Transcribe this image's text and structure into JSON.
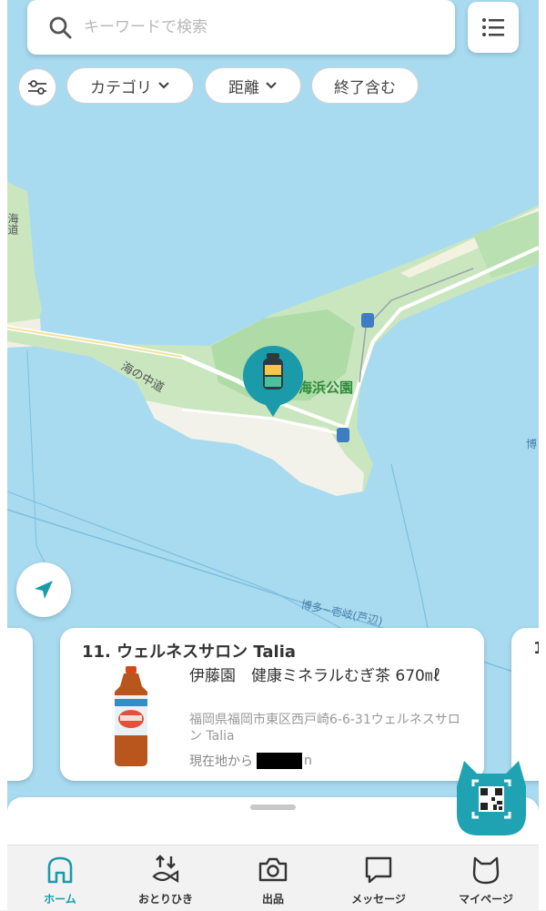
{
  "search": {
    "placeholder": "キーワードで検索"
  },
  "filters": [
    {
      "label": "カテゴリ",
      "has_dropdown": true
    },
    {
      "label": "距離",
      "has_dropdown": true
    },
    {
      "label": "終了含む",
      "has_dropdown": false
    }
  ],
  "map": {
    "labels": {
      "park": "海浜公園",
      "road_umi": "海の中道",
      "road_left": "海道",
      "ferry": "博多~壱岐(芦辺)",
      "right_edge": "博"
    },
    "marker_icon": "bottle-icon"
  },
  "cards": {
    "left_peek": "",
    "main": {
      "title": "11. ウェルネスサロン Talia",
      "product": "伊藤園　健康ミネラルむぎ茶 670㎖",
      "address": "福岡県福岡市東区西戸崎6-6-31ウェルネスサロン Talia",
      "distance_prefix": "現在地から",
      "distance_suffix": "n",
      "product_image": "mugicha-bottle"
    },
    "right_peek": "1"
  },
  "tabs": [
    {
      "label": "ホーム",
      "icon": "home-icon",
      "active": true
    },
    {
      "label": "おとりひき",
      "icon": "exchange-icon",
      "active": false
    },
    {
      "label": "出品",
      "icon": "camera-icon",
      "active": false
    },
    {
      "label": "メッセージ",
      "icon": "message-icon",
      "active": false
    },
    {
      "label": "マイページ",
      "icon": "cat-face-icon",
      "active": false
    }
  ],
  "colors": {
    "accent": "#1b9aaa",
    "water": "#a9dbf0",
    "land": "#c9e6bf",
    "sand": "#f3f1e6"
  }
}
